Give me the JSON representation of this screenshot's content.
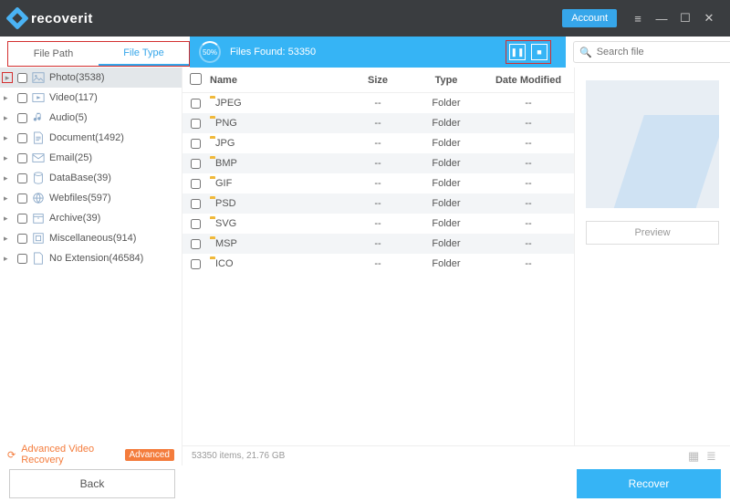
{
  "app": {
    "name": "recoverit",
    "account_label": "Account"
  },
  "tabs": {
    "path": "File Path",
    "type": "File Type"
  },
  "progress": {
    "percent": "50%",
    "found_label": "Files Found: 53350"
  },
  "search": {
    "placeholder": "Search file"
  },
  "categories": [
    {
      "label": "Photo(3538)",
      "icon": "image",
      "selected": true
    },
    {
      "label": "Video(117)",
      "icon": "video"
    },
    {
      "label": "Audio(5)",
      "icon": "audio"
    },
    {
      "label": "Document(1492)",
      "icon": "document"
    },
    {
      "label": "Email(25)",
      "icon": "email"
    },
    {
      "label": "DataBase(39)",
      "icon": "database"
    },
    {
      "label": "Webfiles(597)",
      "icon": "web"
    },
    {
      "label": "Archive(39)",
      "icon": "archive"
    },
    {
      "label": "Miscellaneous(914)",
      "icon": "misc"
    },
    {
      "label": "No Extension(46584)",
      "icon": "noext"
    }
  ],
  "advanced": {
    "label": "Advanced Video Recovery",
    "badge": "Advanced"
  },
  "table": {
    "headers": {
      "name": "Name",
      "size": "Size",
      "type": "Type",
      "date": "Date Modified"
    },
    "rows": [
      {
        "name": "JPEG",
        "size": "--",
        "type": "Folder",
        "date": "--"
      },
      {
        "name": "PNG",
        "size": "--",
        "type": "Folder",
        "date": "--"
      },
      {
        "name": "JPG",
        "size": "--",
        "type": "Folder",
        "date": "--"
      },
      {
        "name": "BMP",
        "size": "--",
        "type": "Folder",
        "date": "--"
      },
      {
        "name": "GIF",
        "size": "--",
        "type": "Folder",
        "date": "--"
      },
      {
        "name": "PSD",
        "size": "--",
        "type": "Folder",
        "date": "--"
      },
      {
        "name": "SVG",
        "size": "--",
        "type": "Folder",
        "date": "--"
      },
      {
        "name": "MSP",
        "size": "--",
        "type": "Folder",
        "date": "--"
      },
      {
        "name": "ICO",
        "size": "--",
        "type": "Folder",
        "date": "--"
      }
    ]
  },
  "preview": {
    "button": "Preview"
  },
  "status": {
    "text": "53350 items, 21.76  GB"
  },
  "footer": {
    "back": "Back",
    "recover": "Recover"
  }
}
